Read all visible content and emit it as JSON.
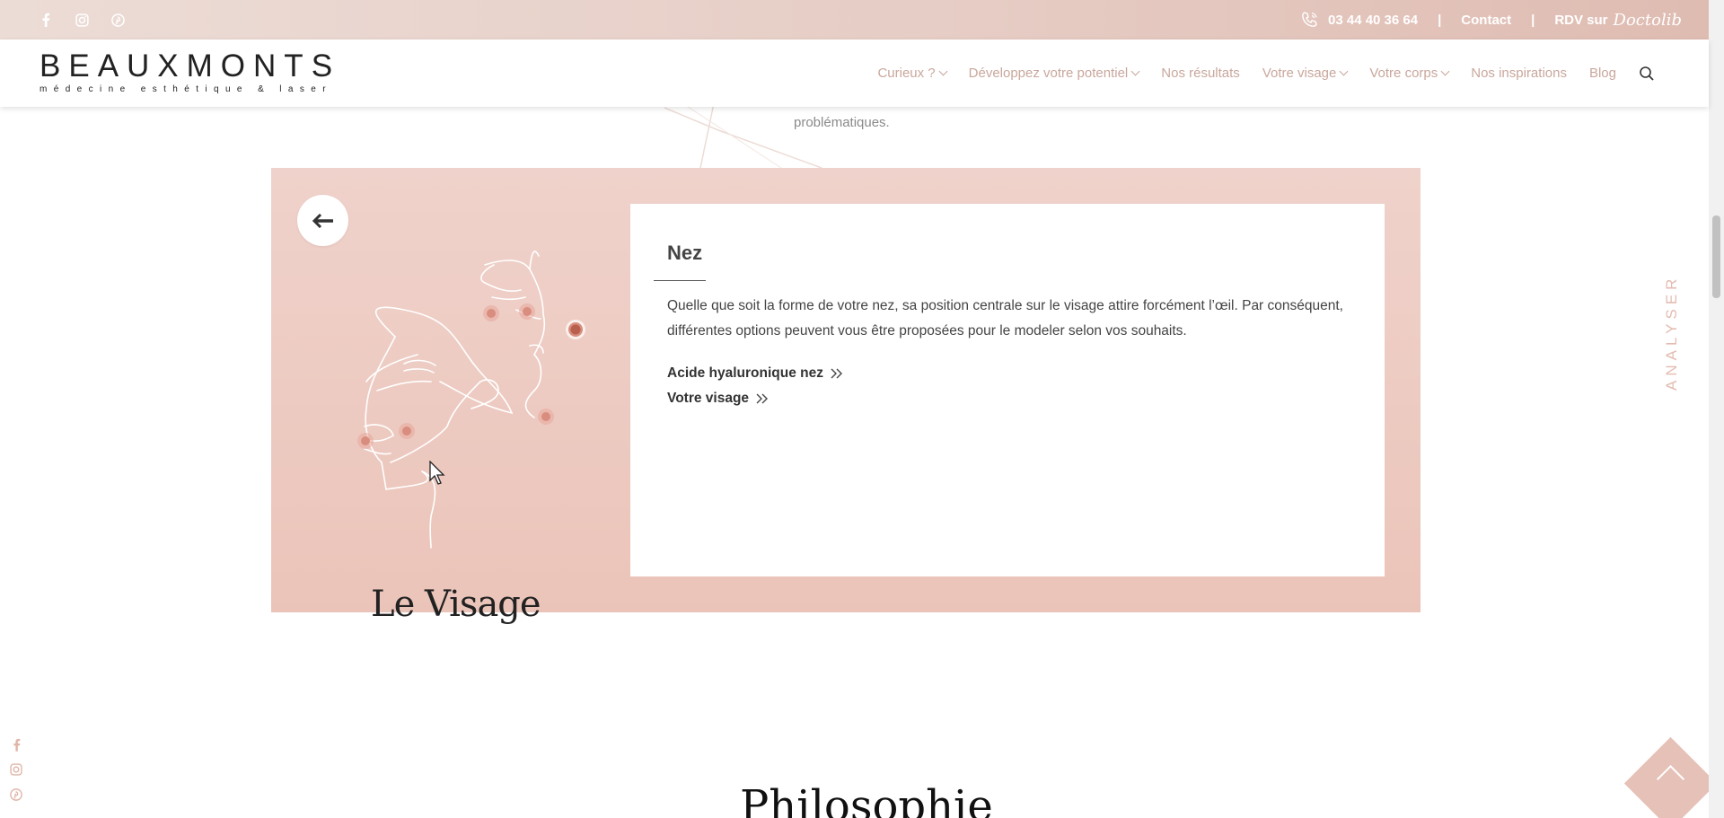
{
  "topbar": {
    "social": [
      "facebook-icon",
      "instagram-icon",
      "pinterest-icon"
    ],
    "phone": "03 44 40 36 64",
    "separator": "|",
    "contact": "Contact",
    "rdv": "RDV sur",
    "doctolib": "Doctolib"
  },
  "header": {
    "logo_word": "BEAUXMONTS",
    "logo_tag": "médecine esthétique & laser",
    "nav": [
      {
        "label": "Curieux ?",
        "dropdown": true
      },
      {
        "label": "Développez votre potentiel",
        "dropdown": true
      },
      {
        "label": "Nos résultats",
        "dropdown": false
      },
      {
        "label": "Votre visage",
        "dropdown": true
      },
      {
        "label": "Votre corps",
        "dropdown": true
      },
      {
        "label": "Nos inspirations",
        "dropdown": false
      },
      {
        "label": "Blog",
        "dropdown": false
      }
    ]
  },
  "above_text": "problématiques.",
  "panel": {
    "card_title": "Nez",
    "card_text": "Quelle que soit la forme de votre nez, sa position centrale sur le visage attire forcément l’œil. Par conséquent, différentes options peuvent vous être proposées pour le modeler selon vos souhaits.",
    "links": [
      "Acide hyaluronique nez",
      "Votre visage"
    ],
    "section_title": "Le Visage"
  },
  "analyser": "ANALYSER",
  "philosophie": "Philosophie",
  "colors": {
    "accent": "#e3bcb1",
    "panel": "#ebc4b9",
    "active_dot": "#b8604d"
  }
}
